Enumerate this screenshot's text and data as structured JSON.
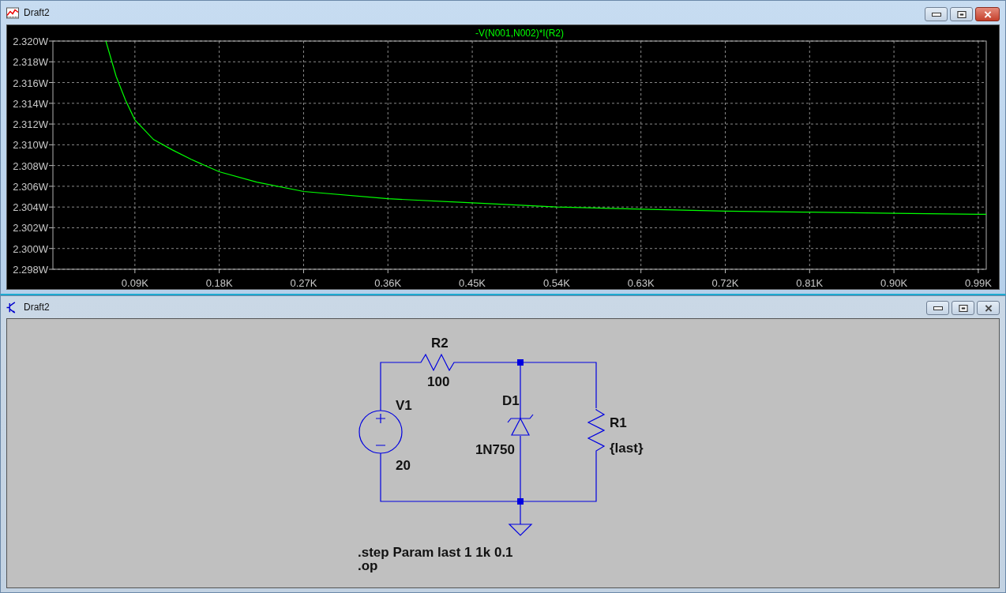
{
  "plot_window": {
    "title": "Draft2",
    "active": true,
    "chart_data": {
      "type": "line",
      "grid": true,
      "series": [
        {
          "name": "-V(N001,N002)*I(R2)",
          "color": "#00ff00",
          "values": [
            2.32,
            2.3166,
            2.3143,
            2.3124,
            2.3105,
            2.3095,
            2.3086,
            2.3074,
            2.3064,
            2.3055,
            2.3048,
            2.3044,
            2.304,
            2.3038,
            2.3036,
            2.3035,
            2.3034,
            2.3033,
            2.3033
          ]
        }
      ],
      "x": [
        0.059,
        0.07,
        0.08,
        0.09,
        0.11,
        0.13,
        0.15,
        0.18,
        0.22,
        0.27,
        0.36,
        0.45,
        0.54,
        0.63,
        0.72,
        0.81,
        0.9,
        0.99,
        0.9985
      ],
      "xlim": [
        0.0025,
        0.9985
      ],
      "ylim": [
        2.298,
        2.32
      ],
      "xticks": [
        {
          "value": 0.09,
          "label": "0.09K"
        },
        {
          "value": 0.18,
          "label": "0.18K"
        },
        {
          "value": 0.27,
          "label": "0.27K"
        },
        {
          "value": 0.36,
          "label": "0.36K"
        },
        {
          "value": 0.45,
          "label": "0.45K"
        },
        {
          "value": 0.54,
          "label": "0.54K"
        },
        {
          "value": 0.63,
          "label": "0.63K"
        },
        {
          "value": 0.72,
          "label": "0.72K"
        },
        {
          "value": 0.81,
          "label": "0.81K"
        },
        {
          "value": 0.9,
          "label": "0.90K"
        },
        {
          "value": 0.99,
          "label": "0.99K"
        }
      ],
      "yticks": [
        {
          "value": 2.32,
          "label": "2.320W"
        },
        {
          "value": 2.318,
          "label": "2.318W"
        },
        {
          "value": 2.316,
          "label": "2.316W"
        },
        {
          "value": 2.314,
          "label": "2.314W"
        },
        {
          "value": 2.312,
          "label": "2.312W"
        },
        {
          "value": 2.31,
          "label": "2.310W"
        },
        {
          "value": 2.308,
          "label": "2.308W"
        },
        {
          "value": 2.306,
          "label": "2.306W"
        },
        {
          "value": 2.304,
          "label": "2.304W"
        },
        {
          "value": 2.302,
          "label": "2.302W"
        },
        {
          "value": 2.3,
          "label": "2.300W"
        },
        {
          "value": 2.298,
          "label": "2.298W"
        }
      ]
    }
  },
  "schematic_window": {
    "title": "Draft2",
    "active": false,
    "components": [
      {
        "kind": "resistor",
        "name": "R2",
        "value": "100"
      },
      {
        "kind": "voltage_source",
        "name": "V1",
        "value": "20"
      },
      {
        "kind": "zener_diode",
        "name": "D1",
        "value": "1N750"
      },
      {
        "kind": "resistor",
        "name": "R1",
        "value": "{last}"
      }
    ],
    "directives": [
      ".step Param last 1 1k 0.1",
      ".op"
    ]
  }
}
